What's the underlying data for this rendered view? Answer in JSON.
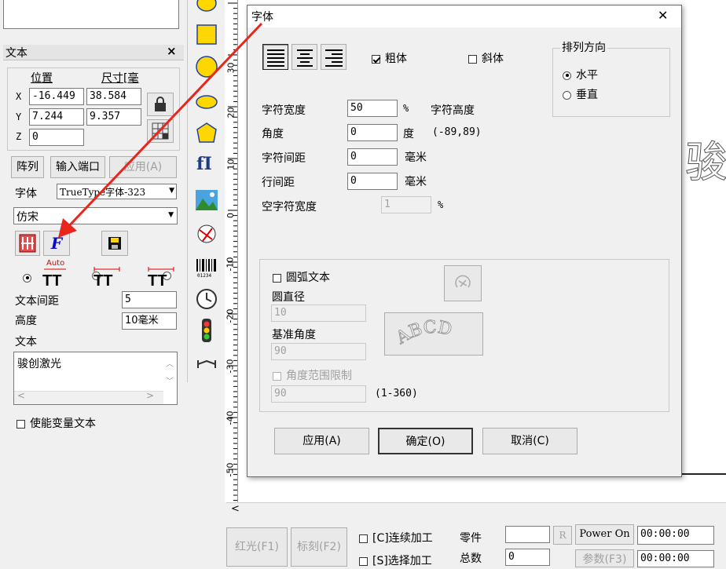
{
  "left_panel": {
    "title": "文本",
    "close_glyph": "×",
    "coord_header_pos": "位置",
    "coord_header_size": "尺寸[毫",
    "x_label": "X",
    "x_pos": "-16.449",
    "x_size": "38.584",
    "y_label": "Y",
    "y_pos": "7.244",
    "y_size": "9.357",
    "z_label": "Z",
    "z_pos": "0",
    "array_btn": "阵列",
    "input_port_btn": "输入端口",
    "apply_btn": "应用(A)",
    "font_label": "字体",
    "font_type_value": "TrueType字体-323",
    "font_name_value": "仿宋",
    "auto_label": "Auto",
    "text_spacing_label": "文本间距",
    "text_spacing_value": "5",
    "height_label": "高度",
    "height_value": "10毫米",
    "text_label": "文本",
    "text_value": "骏创激光",
    "variable_text_label": "使能变量文本"
  },
  "toolbar": {
    "icons": [
      "ellipse-tool",
      "rectangle-tool",
      "circle-tool",
      "ellipse-tool-2",
      "polygon-tool",
      "text-tool",
      "image-tool",
      "vector-import-tool",
      "barcode-tool",
      "clock-tool",
      "io-light-tool",
      "extend-tool"
    ],
    "text_tool_glyph": "fI",
    "barcode_caption": "01234"
  },
  "ruler": {
    "labels": [
      "30",
      "20",
      "10",
      "0",
      "-10",
      "-20",
      "-30",
      "-40",
      "-50"
    ]
  },
  "canvas": {
    "preview_glyph": "骏"
  },
  "dialog": {
    "title": "字体",
    "bold_label": "粗体",
    "italic_label": "斜体",
    "direction_group": "排列方向",
    "horizontal_label": "水平",
    "vertical_label": "垂直",
    "char_width_label": "字符宽度",
    "char_width_value": "50",
    "char_width_unit": "%",
    "char_height_label": "字符高度",
    "angle_label": "角度",
    "angle_value": "0",
    "angle_unit": "度",
    "angle_range": "(-89,89)",
    "char_spacing_label": "字符间距",
    "char_spacing_value": "0",
    "char_spacing_unit": "毫米",
    "line_spacing_label": "行间距",
    "line_spacing_value": "0",
    "line_spacing_unit": "毫米",
    "space_width_label": "空字符宽度",
    "space_width_value": "1",
    "space_width_unit": "%",
    "arc_text_label": "圆弧文本",
    "arc_diameter_label": "圆直径",
    "arc_diameter_value": "10",
    "base_angle_label": "基准角度",
    "base_angle_value": "90",
    "angle_limit_label": "角度范围限制",
    "angle_limit_value": "90",
    "angle_limit_range": "(1-360)",
    "abcd_sample": "ABCD",
    "apply_btn": "应用(A)",
    "ok_btn": "确定(O)",
    "cancel_btn": "取消(C)",
    "close_glyph": "✕"
  },
  "bottom": {
    "red_light_btn": "红光(F1)",
    "mark_btn": "标刻(F2)",
    "continuous_label": "[C]连续加工",
    "select_label": "[S]选择加工",
    "parts_label": "零件",
    "total_label": "总数",
    "total_value": "0",
    "r_btn": "R",
    "power_btn": "Power On",
    "params_btn": "参数(F3)",
    "time1": "00:00:00",
    "time2": "00:00:00",
    "scroll_left": "<"
  },
  "colors": {
    "arrow": "#e8261c",
    "accent": "#0a0acc",
    "yellow": "#ffd700"
  }
}
